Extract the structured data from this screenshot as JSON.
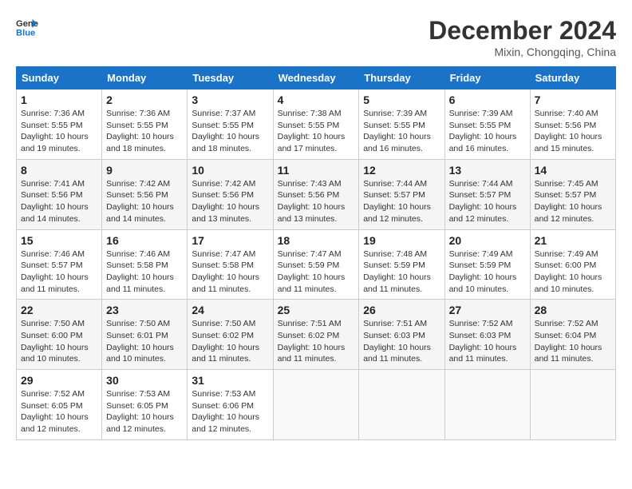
{
  "header": {
    "logo_line1": "General",
    "logo_line2": "Blue",
    "month": "December 2024",
    "location": "Mixin, Chongqing, China"
  },
  "weekdays": [
    "Sunday",
    "Monday",
    "Tuesday",
    "Wednesday",
    "Thursday",
    "Friday",
    "Saturday"
  ],
  "weeks": [
    [
      {
        "day": "1",
        "sunrise": "7:36 AM",
        "sunset": "5:55 PM",
        "daylight": "10 hours and 19 minutes."
      },
      {
        "day": "2",
        "sunrise": "7:36 AM",
        "sunset": "5:55 PM",
        "daylight": "10 hours and 18 minutes."
      },
      {
        "day": "3",
        "sunrise": "7:37 AM",
        "sunset": "5:55 PM",
        "daylight": "10 hours and 18 minutes."
      },
      {
        "day": "4",
        "sunrise": "7:38 AM",
        "sunset": "5:55 PM",
        "daylight": "10 hours and 17 minutes."
      },
      {
        "day": "5",
        "sunrise": "7:39 AM",
        "sunset": "5:55 PM",
        "daylight": "10 hours and 16 minutes."
      },
      {
        "day": "6",
        "sunrise": "7:39 AM",
        "sunset": "5:55 PM",
        "daylight": "10 hours and 16 minutes."
      },
      {
        "day": "7",
        "sunrise": "7:40 AM",
        "sunset": "5:56 PM",
        "daylight": "10 hours and 15 minutes."
      }
    ],
    [
      {
        "day": "8",
        "sunrise": "7:41 AM",
        "sunset": "5:56 PM",
        "daylight": "10 hours and 14 minutes."
      },
      {
        "day": "9",
        "sunrise": "7:42 AM",
        "sunset": "5:56 PM",
        "daylight": "10 hours and 14 minutes."
      },
      {
        "day": "10",
        "sunrise": "7:42 AM",
        "sunset": "5:56 PM",
        "daylight": "10 hours and 13 minutes."
      },
      {
        "day": "11",
        "sunrise": "7:43 AM",
        "sunset": "5:56 PM",
        "daylight": "10 hours and 13 minutes."
      },
      {
        "day": "12",
        "sunrise": "7:44 AM",
        "sunset": "5:57 PM",
        "daylight": "10 hours and 12 minutes."
      },
      {
        "day": "13",
        "sunrise": "7:44 AM",
        "sunset": "5:57 PM",
        "daylight": "10 hours and 12 minutes."
      },
      {
        "day": "14",
        "sunrise": "7:45 AM",
        "sunset": "5:57 PM",
        "daylight": "10 hours and 12 minutes."
      }
    ],
    [
      {
        "day": "15",
        "sunrise": "7:46 AM",
        "sunset": "5:57 PM",
        "daylight": "10 hours and 11 minutes."
      },
      {
        "day": "16",
        "sunrise": "7:46 AM",
        "sunset": "5:58 PM",
        "daylight": "10 hours and 11 minutes."
      },
      {
        "day": "17",
        "sunrise": "7:47 AM",
        "sunset": "5:58 PM",
        "daylight": "10 hours and 11 minutes."
      },
      {
        "day": "18",
        "sunrise": "7:47 AM",
        "sunset": "5:59 PM",
        "daylight": "10 hours and 11 minutes."
      },
      {
        "day": "19",
        "sunrise": "7:48 AM",
        "sunset": "5:59 PM",
        "daylight": "10 hours and 11 minutes."
      },
      {
        "day": "20",
        "sunrise": "7:49 AM",
        "sunset": "5:59 PM",
        "daylight": "10 hours and 10 minutes."
      },
      {
        "day": "21",
        "sunrise": "7:49 AM",
        "sunset": "6:00 PM",
        "daylight": "10 hours and 10 minutes."
      }
    ],
    [
      {
        "day": "22",
        "sunrise": "7:50 AM",
        "sunset": "6:00 PM",
        "daylight": "10 hours and 10 minutes."
      },
      {
        "day": "23",
        "sunrise": "7:50 AM",
        "sunset": "6:01 PM",
        "daylight": "10 hours and 10 minutes."
      },
      {
        "day": "24",
        "sunrise": "7:50 AM",
        "sunset": "6:02 PM",
        "daylight": "10 hours and 11 minutes."
      },
      {
        "day": "25",
        "sunrise": "7:51 AM",
        "sunset": "6:02 PM",
        "daylight": "10 hours and 11 minutes."
      },
      {
        "day": "26",
        "sunrise": "7:51 AM",
        "sunset": "6:03 PM",
        "daylight": "10 hours and 11 minutes."
      },
      {
        "day": "27",
        "sunrise": "7:52 AM",
        "sunset": "6:03 PM",
        "daylight": "10 hours and 11 minutes."
      },
      {
        "day": "28",
        "sunrise": "7:52 AM",
        "sunset": "6:04 PM",
        "daylight": "10 hours and 11 minutes."
      }
    ],
    [
      {
        "day": "29",
        "sunrise": "7:52 AM",
        "sunset": "6:05 PM",
        "daylight": "10 hours and 12 minutes."
      },
      {
        "day": "30",
        "sunrise": "7:53 AM",
        "sunset": "6:05 PM",
        "daylight": "10 hours and 12 minutes."
      },
      {
        "day": "31",
        "sunrise": "7:53 AM",
        "sunset": "6:06 PM",
        "daylight": "10 hours and 12 minutes."
      },
      null,
      null,
      null,
      null
    ]
  ]
}
